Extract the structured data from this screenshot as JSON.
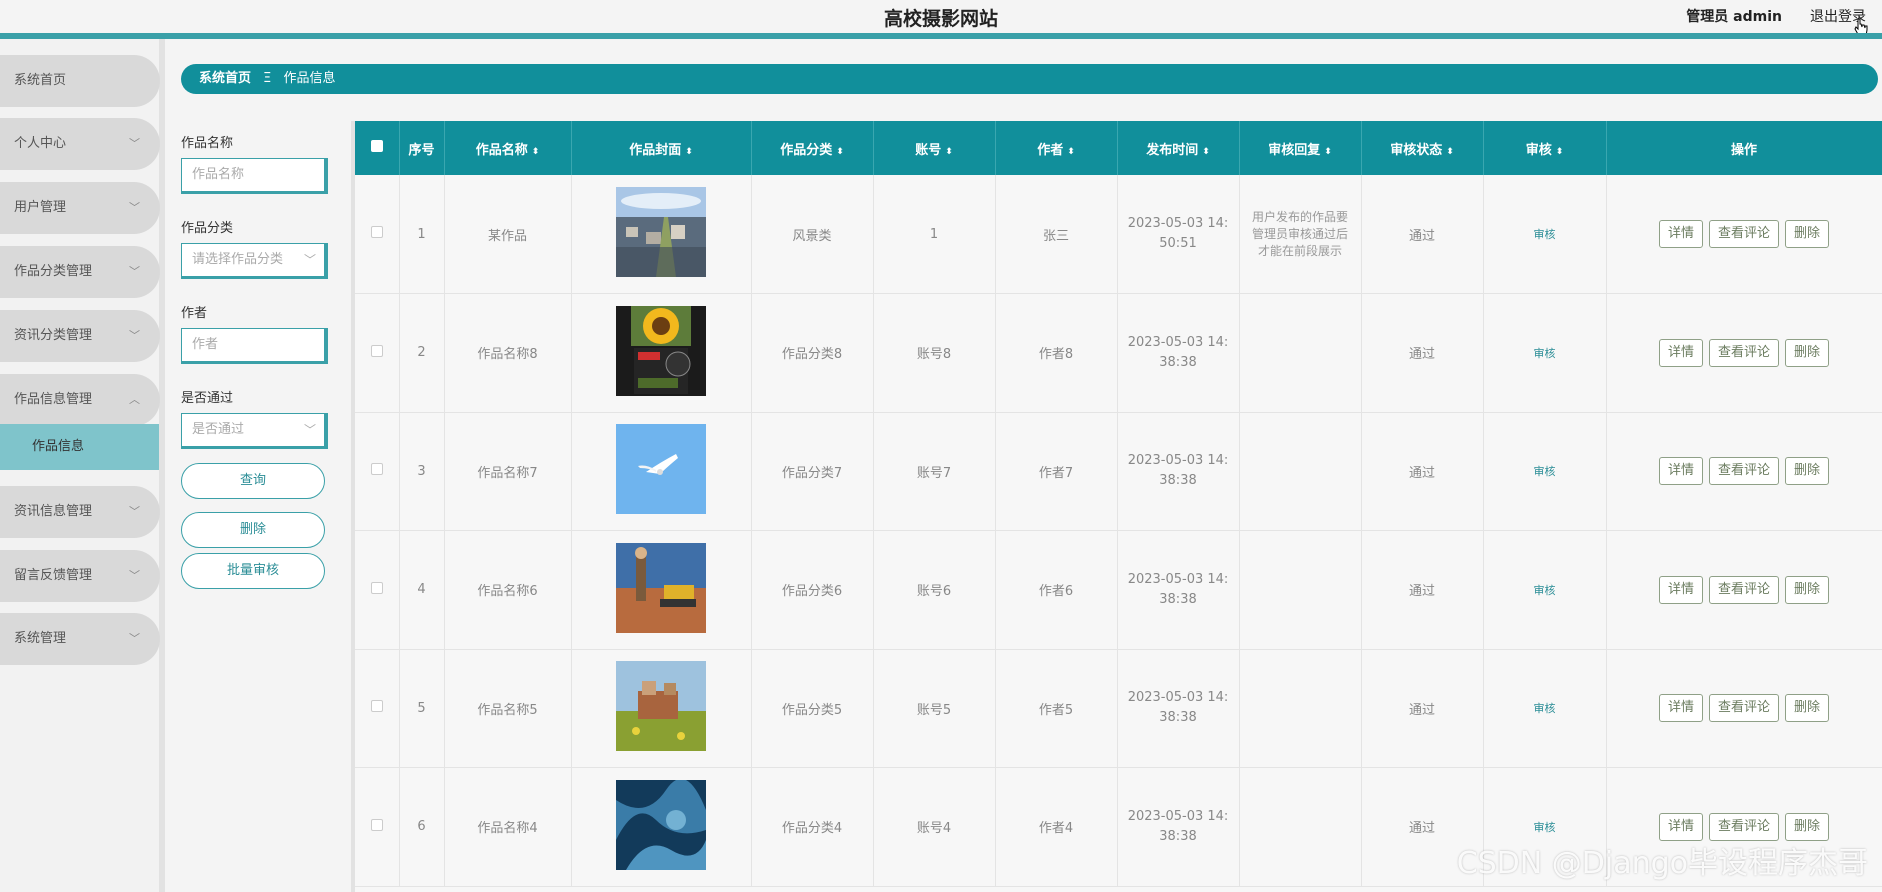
{
  "header": {
    "site_title": "高校摄影网站",
    "admin_label": "管理员 admin",
    "logout_label": "退出登录"
  },
  "sidebar": {
    "items": [
      {
        "label": "系统首页",
        "chevron": ""
      },
      {
        "label": "个人中心",
        "chevron": "﹀"
      },
      {
        "label": "用户管理",
        "chevron": "﹀"
      },
      {
        "label": "作品分类管理",
        "chevron": "﹀"
      },
      {
        "label": "资讯分类管理",
        "chevron": "﹀"
      },
      {
        "label": "作品信息管理",
        "chevron": "︿"
      },
      {
        "label": "资讯信息管理",
        "chevron": "﹀"
      },
      {
        "label": "留言反馈管理",
        "chevron": "﹀"
      },
      {
        "label": "系统管理",
        "chevron": "﹀"
      }
    ],
    "active_sub": "作品信息"
  },
  "breadcrumb": {
    "home": "系统首页",
    "separator": "Ξ",
    "current": "作品信息"
  },
  "search": {
    "name_label": "作品名称",
    "name_placeholder": "作品名称",
    "category_label": "作品分类",
    "category_placeholder": "请选择作品分类",
    "author_label": "作者",
    "author_placeholder": "作者",
    "pass_label": "是否通过",
    "pass_placeholder": "是否通过",
    "query_button": "查询",
    "delete_button": "删除",
    "batch_audit_button": "批量审核"
  },
  "table": {
    "columns": [
      "序号",
      "作品名称",
      "作品封面",
      "作品分类",
      "账号",
      "作者",
      "发布时间",
      "审核回复",
      "审核状态",
      "审核",
      "操作"
    ],
    "rows": [
      {
        "index": "1",
        "name": "某作品",
        "category": "风景类",
        "account": "1",
        "author": "张三",
        "time": "2023-05-03 14:50:51",
        "reply": "用户发布的作品要管理员审核通过后才能在前段展示",
        "status": "通过",
        "audit": "审核",
        "cover": "city"
      },
      {
        "index": "2",
        "name": "作品名称8",
        "category": "作品分类8",
        "account": "账号8",
        "author": "作者8",
        "time": "2023-05-03 14:38:38",
        "reply": "",
        "status": "通过",
        "audit": "审核",
        "cover": "sunflower"
      },
      {
        "index": "3",
        "name": "作品名称7",
        "category": "作品分类7",
        "account": "账号7",
        "author": "作者7",
        "time": "2023-05-03 14:38:38",
        "reply": "",
        "status": "通过",
        "audit": "审核",
        "cover": "bird"
      },
      {
        "index": "4",
        "name": "作品名称6",
        "category": "作品分类6",
        "account": "账号6",
        "author": "作者6",
        "time": "2023-05-03 14:38:38",
        "reply": "",
        "status": "通过",
        "audit": "审核",
        "cover": "bulldozer"
      },
      {
        "index": "5",
        "name": "作品名称5",
        "category": "作品分类5",
        "account": "账号5",
        "author": "作者5",
        "time": "2023-05-03 14:38:38",
        "reply": "",
        "status": "通过",
        "audit": "审核",
        "cover": "field"
      },
      {
        "index": "6",
        "name": "作品名称4",
        "category": "作品分类4",
        "account": "账号4",
        "author": "作者4",
        "time": "2023-05-03 14:38:38",
        "reply": "",
        "status": "通过",
        "audit": "审核",
        "cover": "abstract"
      }
    ],
    "op_detail": "详情",
    "op_comments": "查看评论",
    "op_delete": "删除"
  },
  "watermark": "CSDN @Django毕设程序杰哥",
  "colors": {
    "accent": "#118f9b",
    "accent_light": "#7fc4cb",
    "sidebar_item": "#d9d9d9"
  }
}
